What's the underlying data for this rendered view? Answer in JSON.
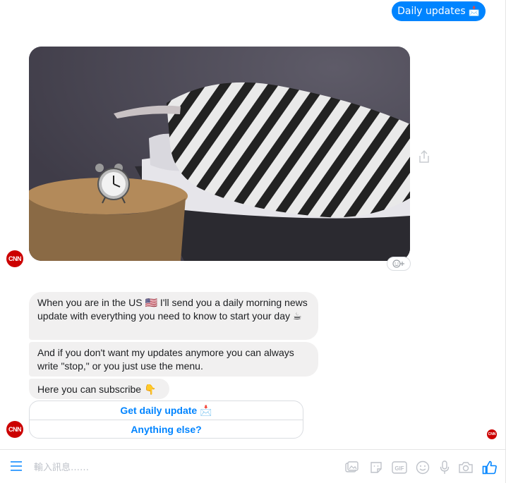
{
  "user_message": {
    "text": "Daily updates",
    "emoji": "📩"
  },
  "bot": {
    "avatar_label": "CNN",
    "messages": [
      {
        "text": "When you are in the US 🇺🇸 I'll send you a daily morning news update with everything you need to know to start your day ☕"
      },
      {
        "text": "And if you don't want my updates anymore you can always write \"stop,\" or you just use the menu."
      },
      {
        "text": "Here you can subscribe 👇"
      }
    ],
    "quick_replies": [
      {
        "label": "Get daily update",
        "emoji": "📩"
      },
      {
        "label": "Anything else?"
      }
    ]
  },
  "seen_label": "CNN",
  "composer": {
    "placeholder": "輸入訊息……"
  },
  "colors": {
    "accent": "#0084ff",
    "bubble_gray": "#f1f0f0",
    "cnn_red": "#cc0000"
  },
  "icons": [
    "menu-icon",
    "share-icon",
    "react-icon",
    "image-icon",
    "sticker-icon",
    "gif-icon",
    "emoji-icon",
    "microphone-icon",
    "camera-icon",
    "like-icon"
  ]
}
